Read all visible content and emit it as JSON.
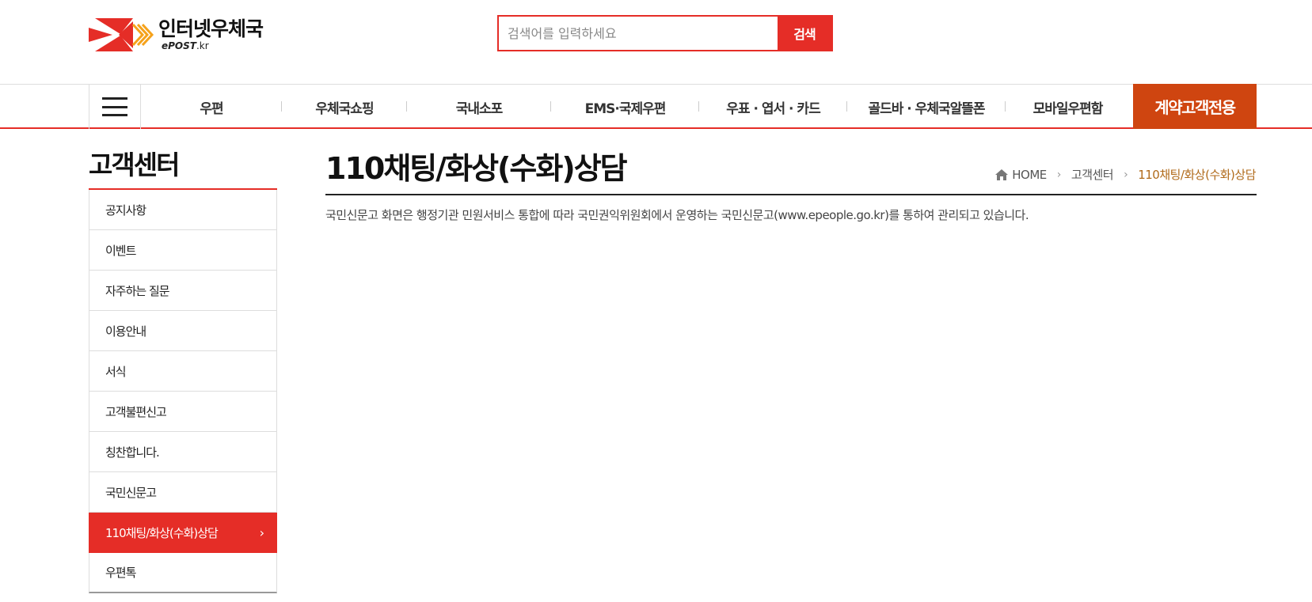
{
  "header": {
    "logo_title": "인터넷우체국",
    "logo_sub": "ePOST",
    "logo_sub_domain": ".kr",
    "search_placeholder": "검색어를 입력하세요",
    "search_button": "검색"
  },
  "gnb": {
    "items": [
      "우편",
      "우체국쇼핑",
      "국내소포",
      "EMS·국제우편",
      "우표 · 엽서 · 카드",
      "골드바 · 우체국알뜰폰",
      "모바일우편함"
    ],
    "contract": "계약고객전용"
  },
  "sidebar": {
    "title": "고객센터",
    "items": [
      "공지사항",
      "이벤트",
      "자주하는 질문",
      "이용안내",
      "서식",
      "고객불편신고",
      "칭찬합니다.",
      "국민신문고",
      "110채팅/화상(수화)상담",
      "우편톡"
    ],
    "active_index": 8
  },
  "content": {
    "title": "110채팅/화상(수화)상담",
    "breadcrumb": {
      "home": "HOME",
      "level1": "고객센터",
      "current": "110채팅/화상(수화)상담"
    },
    "description": "국민신문고 화면은 행정기관 민원서비스 통합에 따라 국민권익위원회에서 운영하는 국민신문고(www.epeople.go.kr)를 통하여 관리되고 있습니다."
  },
  "colors": {
    "brand_red": "#e52d27",
    "contract_orange": "#cf4510",
    "breadcrumb_current": "#b06a1a"
  }
}
